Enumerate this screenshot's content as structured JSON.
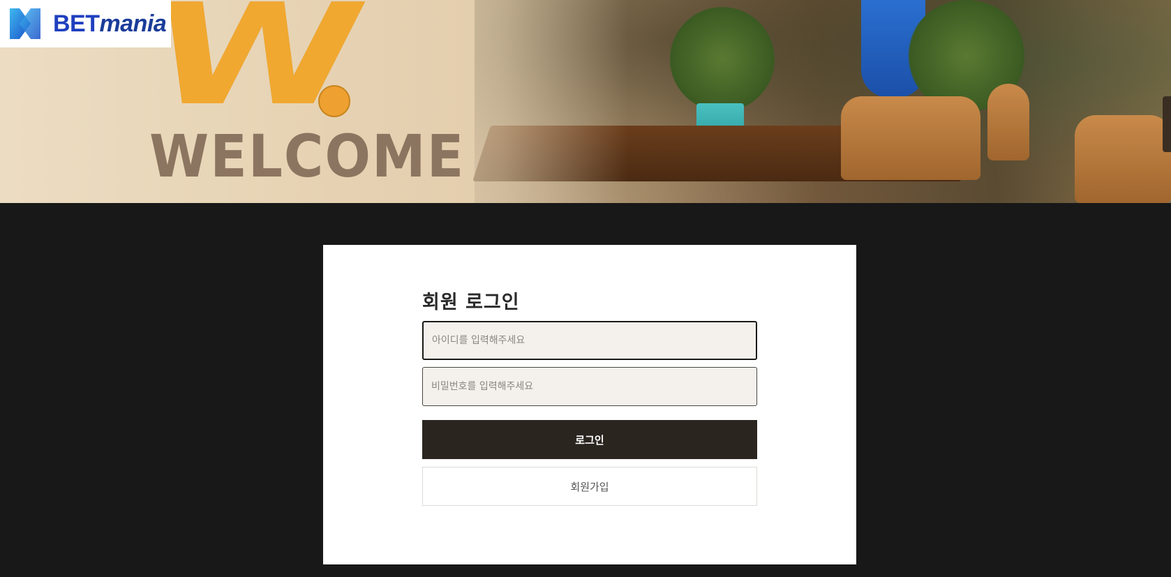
{
  "header": {
    "logo": {
      "icon": "betmania-logo-icon",
      "text_bet": "BET",
      "text_mania": "mania"
    },
    "banner": {
      "heading_letter": "W",
      "heading_text": "WELCOME",
      "image": "cafe-interior-photo"
    }
  },
  "login": {
    "title": "회원 로그인",
    "id_field": {
      "placeholder": "아이디를 입력해주세요",
      "value": ""
    },
    "password_field": {
      "placeholder": "비밀번호를 입력해주세요",
      "value": ""
    },
    "login_button": "로그인",
    "signup_button": "회원가입"
  },
  "colors": {
    "page_background": "#181818",
    "card_background": "#ffffff",
    "primary_button": "#2b2520",
    "input_background": "#f4f1ed",
    "welcome_orange": "#f0a830",
    "welcome_brown": "#8c7560",
    "logo_blue": "#1f3fbf"
  }
}
